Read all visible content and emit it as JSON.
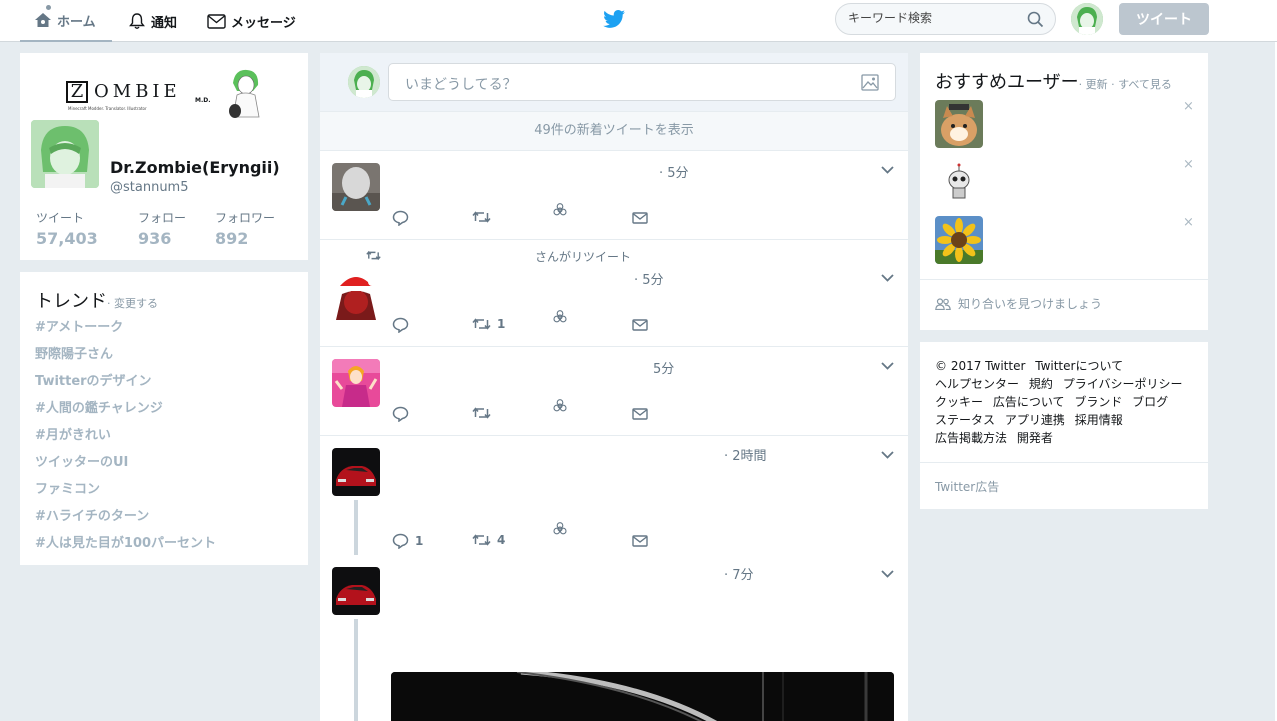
{
  "nav": {
    "home_label": "ホーム",
    "notifications_label": "通知",
    "messages_label": "メッセージ",
    "search_placeholder": "キーワード検索",
    "tweet_button": "ツイート"
  },
  "profile": {
    "banner_logo_initial": "Z",
    "banner_logo_rest": "OMBIE",
    "banner_logo_md": "M.D.",
    "banner_logo_sub": "Minecraft Modder. Translator. Illustrator",
    "name": "Dr.Zombie(Eryngii)",
    "handle": "@stannum5",
    "stats": [
      {
        "label": "ツイート",
        "value": "57,403"
      },
      {
        "label": "フォロー",
        "value": "936"
      },
      {
        "label": "フォロワー",
        "value": "892"
      }
    ]
  },
  "trends": {
    "title": "トレンド",
    "change": "· 変更する",
    "items": [
      "#アメトーーク",
      "野際陽子さん",
      "Twitterのデザイン",
      "#人間の鑑チャレンジ",
      "#月がきれい",
      "ツイッターのUI",
      "ファミコン",
      "#ハライチのターン",
      "#人は見た目が100パーセント"
    ]
  },
  "timeline": {
    "compose_placeholder": "いまどうしてる？",
    "new_tweets": "49件の新着ツイートを表示",
    "tweets": [
      {
        "time": "· 5分",
        "replies": "",
        "retweets": "",
        "likes": ""
      },
      {
        "retweet_note": "さんがリツイート",
        "time": "· 5分",
        "replies": "",
        "retweets": "1",
        "likes": ""
      },
      {
        "time": "5分",
        "replies": "",
        "retweets": "",
        "likes": ""
      },
      {
        "time": "· 2時間",
        "replies": "1",
        "retweets": "4",
        "likes": ""
      },
      {
        "time": "· 7分",
        "replies": "",
        "retweets": "",
        "likes": ""
      }
    ]
  },
  "who_to_follow": {
    "title": "おすすめユーザー",
    "links": "· 更新 · すべて見る",
    "close": "×",
    "find_friends": "知り合いを見つけましょう"
  },
  "footer": {
    "links": [
      "© 2017 Twitter",
      "Twitterについて",
      "ヘルプセンター",
      "規約",
      "プライバシーポリシー",
      "クッキー",
      "広告について",
      "ブランド",
      "ブログ",
      "ステータス",
      "アプリ連携",
      "採用情報",
      "広告掲載方法",
      "開発者"
    ],
    "ads": "Twitter広告"
  },
  "colors": {
    "brand": "#1da1f2",
    "background": "#e6ecf0",
    "muted": "#657786",
    "faded_text": "#a4b5c2",
    "tweet_button_disabled": "#bcc6cf"
  }
}
